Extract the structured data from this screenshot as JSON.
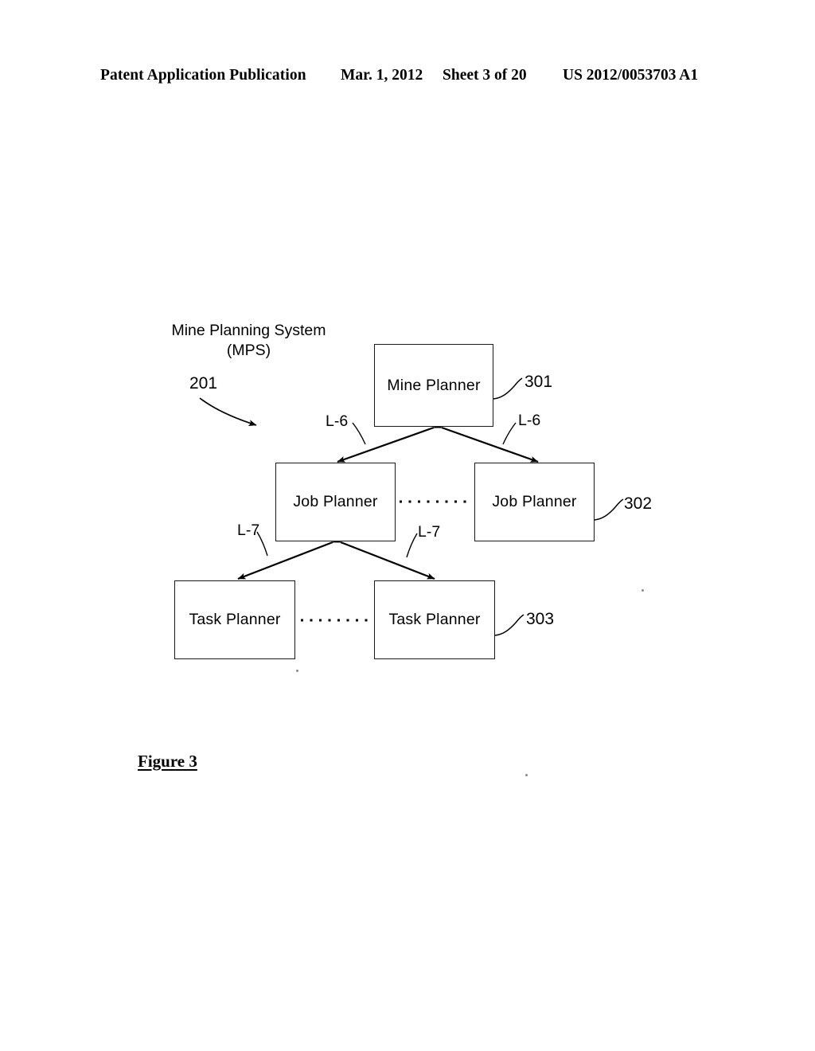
{
  "header": {
    "publication": "Patent Application Publication",
    "date": "Mar. 1, 2012",
    "sheet": "Sheet 3 of 20",
    "publication_number": "US 2012/0053703 A1"
  },
  "figure": {
    "caption": "Figure 3",
    "system_title_line1": "Mine Planning System",
    "system_title_line2": "(MPS)",
    "system_reference": "201"
  },
  "nodes": [
    {
      "id": "mine-planner",
      "label": "Mine Planner",
      "reference": "301"
    },
    {
      "id": "job-planner-1",
      "label": "Job Planner",
      "reference": ""
    },
    {
      "id": "job-planner-2",
      "label": "Job Planner",
      "reference": "302"
    },
    {
      "id": "task-planner-1",
      "label": "Task Planner",
      "reference": ""
    },
    {
      "id": "task-planner-2",
      "label": "Task Planner",
      "reference": "303"
    }
  ],
  "references": {
    "mine_planner": "301",
    "job_planner": "302",
    "task_planner": "303"
  },
  "links": [
    {
      "label": "L-6",
      "from": "job-planner-1",
      "to": "mine-planner",
      "style": "bidirectional"
    },
    {
      "label": "L-6",
      "from": "job-planner-2",
      "to": "mine-planner",
      "style": "bidirectional"
    },
    {
      "label": "L-7",
      "from": "task-planner-1",
      "to": "job-planner-1",
      "style": "bidirectional"
    },
    {
      "label": "L-7",
      "from": "task-planner-2",
      "to": "job-planner-1",
      "style": "bidirectional"
    }
  ],
  "link_labels": {
    "l6_left": "L-6",
    "l6_right": "L-6",
    "l7_left": "L-7",
    "l7_right": "L-7"
  },
  "colors": {
    "ink": "#000000",
    "page": "#ffffff"
  }
}
